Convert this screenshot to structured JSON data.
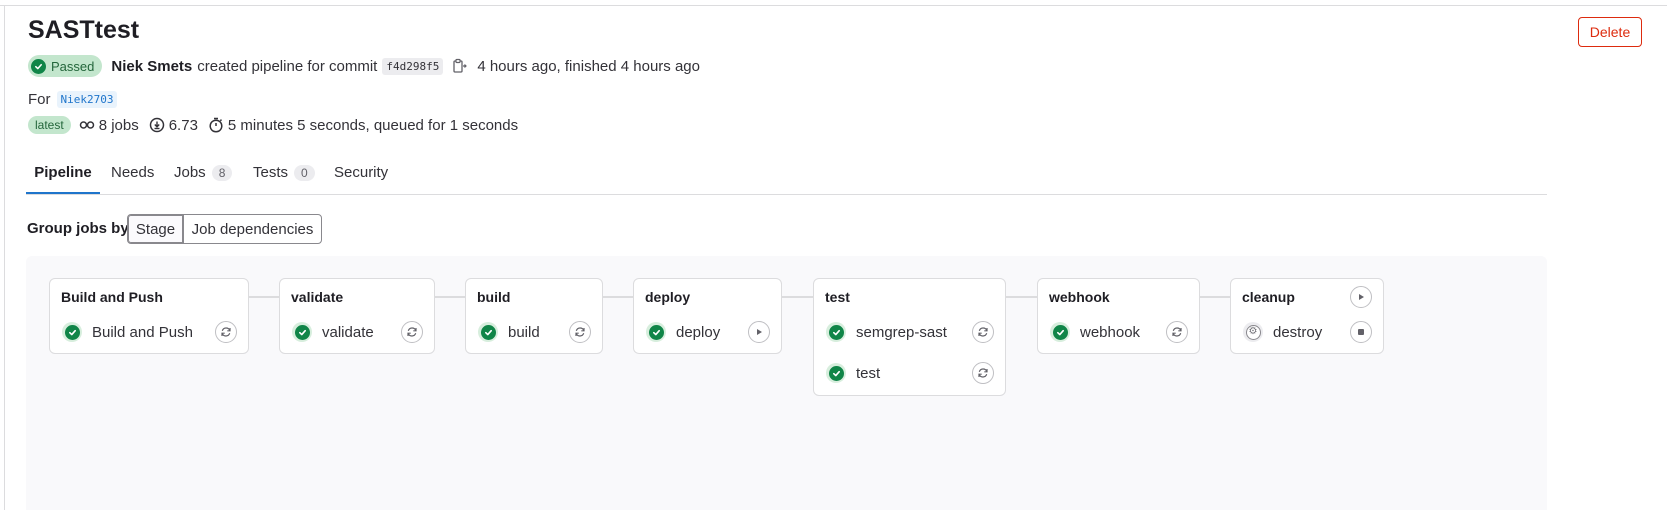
{
  "header": {
    "title": "SASTtest",
    "delete_label": "Delete"
  },
  "summary": {
    "status": "Passed",
    "author": "Niek Smets",
    "action_text": "created pipeline for commit",
    "commit_sha": "f4d298f5",
    "time_text": "4 hours ago, finished 4 hours ago",
    "for_label": "For",
    "ref": "Niek2703",
    "latest_label": "latest",
    "jobs_text": "8 jobs",
    "score_text": "6.73",
    "duration_text": "5 minutes 5 seconds, queued for 1 seconds"
  },
  "tabs": [
    {
      "label": "Pipeline"
    },
    {
      "label": "Needs"
    },
    {
      "label": "Jobs",
      "count": "8"
    },
    {
      "label": "Tests",
      "count": "0"
    },
    {
      "label": "Security"
    }
  ],
  "grouping": {
    "label": "Group jobs by",
    "options": [
      "Stage",
      "Job dependencies"
    ],
    "selected": "Stage"
  },
  "stages": [
    {
      "name": "Build and Push",
      "jobs": [
        {
          "name": "Build and Push",
          "status": "passed",
          "action": "retry-icon"
        }
      ]
    },
    {
      "name": "validate",
      "jobs": [
        {
          "name": "validate",
          "status": "passed",
          "action": "retry-icon"
        }
      ]
    },
    {
      "name": "build",
      "jobs": [
        {
          "name": "build",
          "status": "passed",
          "action": "retry-icon"
        }
      ]
    },
    {
      "name": "deploy",
      "jobs": [
        {
          "name": "deploy",
          "status": "passed",
          "action": "play-icon"
        }
      ]
    },
    {
      "name": "test",
      "jobs": [
        {
          "name": "semgrep-sast",
          "status": "passed",
          "action": "retry-icon"
        },
        {
          "name": "test",
          "status": "passed",
          "action": "retry-icon"
        }
      ]
    },
    {
      "name": "webhook",
      "jobs": [
        {
          "name": "webhook",
          "status": "passed",
          "action": "retry-icon"
        }
      ]
    },
    {
      "name": "cleanup",
      "stage_action": "play-icon",
      "jobs": [
        {
          "name": "destroy",
          "status": "manual",
          "action": "stop-icon"
        }
      ]
    }
  ],
  "colors": {
    "success": "#108548",
    "danger": "#dd2b0e",
    "link": "#1f75cb"
  }
}
